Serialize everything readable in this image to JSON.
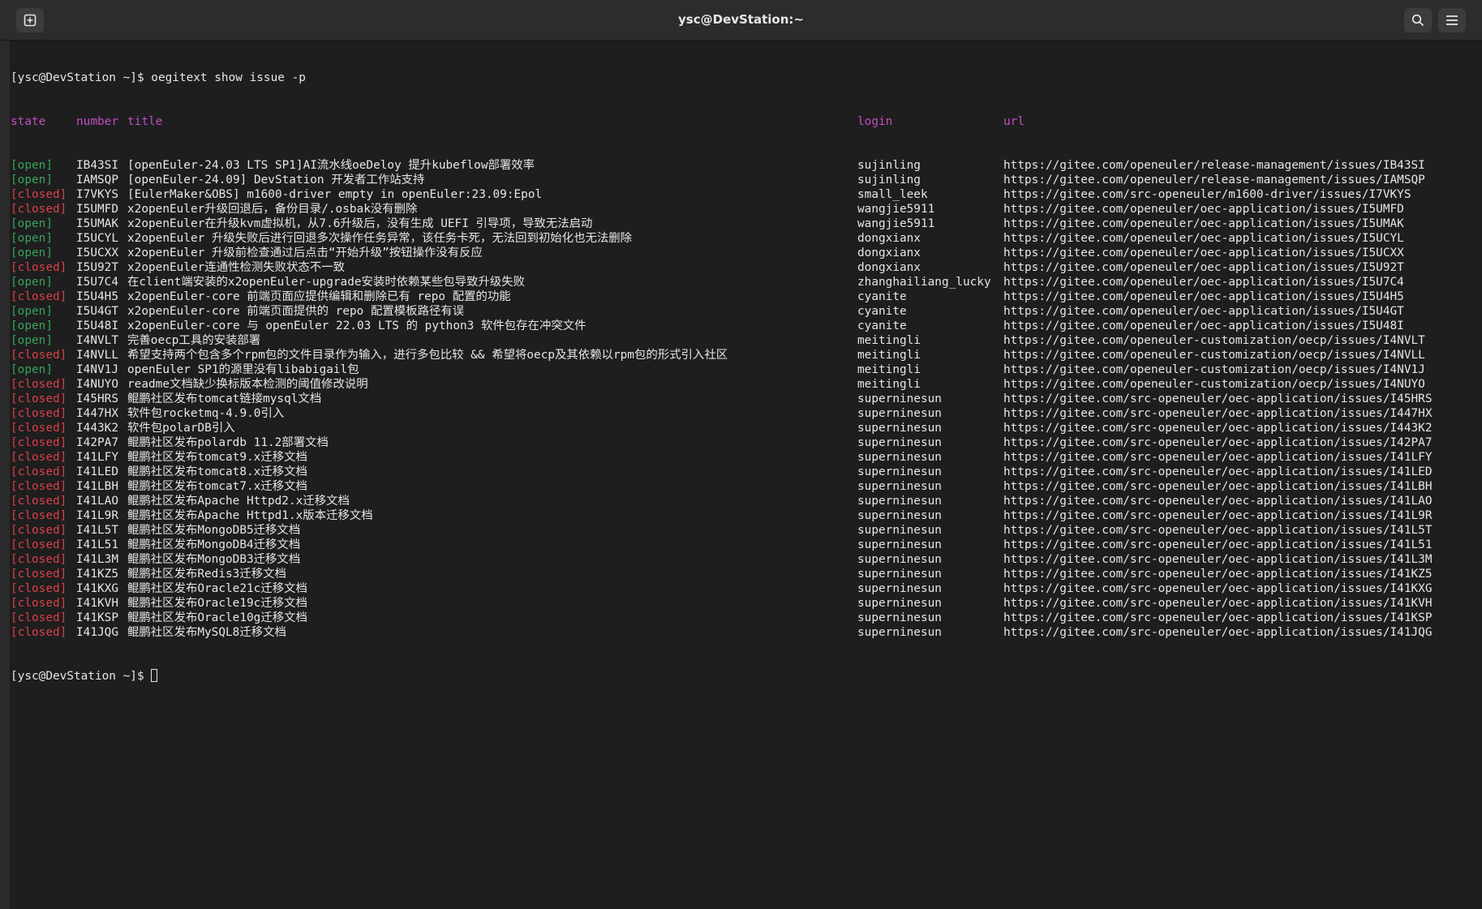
{
  "window": {
    "title": "ysc@DevStation:~",
    "new_tab_icon": "new-tab-icon",
    "search_icon": "search-icon",
    "menu_icon": "hamburger-menu-icon"
  },
  "terminal": {
    "prompt": "[ysc@DevStation ~]$",
    "command": " oegitext show issue -p",
    "headers": {
      "state": "state",
      "number": "number",
      "title": "title",
      "login": "login",
      "url": "url"
    },
    "colors": {
      "header": "#c24ec2",
      "open": "#35a35c",
      "closed": "#d9404a",
      "text": "#e6e6e6",
      "background": "#1e1e1e"
    },
    "rows": [
      {
        "state": "[open]",
        "number": "IB43SI",
        "title": "[openEuler-24.03 LTS SP1]AI流水线oeDeloy 提升kubeflow部署效率",
        "login": "sujinling",
        "url": "https://gitee.com/openeuler/release-management/issues/IB43SI"
      },
      {
        "state": "[open]",
        "number": "IAMSQP",
        "title": "[openEuler-24.09] DevStation 开发者工作站支持",
        "login": "sujinling",
        "url": "https://gitee.com/openeuler/release-management/issues/IAMSQP"
      },
      {
        "state": "[closed]",
        "number": "I7VKYS",
        "title": "[EulerMaker&OBS] m1600-driver empty in openEuler:23.09:Epol",
        "login": "small_leek",
        "url": "https://gitee.com/src-openeuler/m1600-driver/issues/I7VKYS"
      },
      {
        "state": "[closed]",
        "number": "I5UMFD",
        "title": "x2openEuler升级回退后，备份目录/.osbak没有删除",
        "login": "wangjie5911",
        "url": "https://gitee.com/openeuler/oec-application/issues/I5UMFD"
      },
      {
        "state": "[open]",
        "number": "I5UMAK",
        "title": "x2openEuler在升级kvm虚拟机，从7.6升级后，没有生成 UEFI 引导项，导致无法启动",
        "login": "wangjie5911",
        "url": "https://gitee.com/openeuler/oec-application/issues/I5UMAK"
      },
      {
        "state": "[open]",
        "number": "I5UCYL",
        "title": "x2openEuler 升级失败后进行回退多次操作任务异常，该任务卡死，无法回到初始化也无法删除",
        "login": "dongxianx",
        "url": "https://gitee.com/openeuler/oec-application/issues/I5UCYL"
      },
      {
        "state": "[open]",
        "number": "I5UCXX",
        "title": "x2openEuler 升级前检查通过后点击“开始升级”按钮操作没有反应",
        "login": "dongxianx",
        "url": "https://gitee.com/openeuler/oec-application/issues/I5UCXX"
      },
      {
        "state": "[closed]",
        "number": "I5U92T",
        "title": "x2openEuler连通性检测失败状态不一致",
        "login": "dongxianx",
        "url": "https://gitee.com/openeuler/oec-application/issues/I5U92T"
      },
      {
        "state": "[open]",
        "number": "I5U7C4",
        "title": "在client端安装的x2openEuler-upgrade安装时依赖某些包导致升级失败",
        "login": "zhanghailiang_lucky",
        "url": "https://gitee.com/openeuler/oec-application/issues/I5U7C4"
      },
      {
        "state": "[closed]",
        "number": "I5U4H5",
        "title": "x2openEuler-core 前端页面应提供编辑和删除已有 repo 配置的功能",
        "login": "cyanite",
        "url": "https://gitee.com/openeuler/oec-application/issues/I5U4H5"
      },
      {
        "state": "[open]",
        "number": "I5U4GT",
        "title": "x2openEuler-core 前端页面提供的 repo 配置模板路径有误",
        "login": "cyanite",
        "url": "https://gitee.com/openeuler/oec-application/issues/I5U4GT"
      },
      {
        "state": "[open]",
        "number": "I5U48I",
        "title": "x2openEuler-core 与 openEuler 22.03 LTS 的 python3 软件包存在冲突文件",
        "login": "cyanite",
        "url": "https://gitee.com/openeuler/oec-application/issues/I5U48I"
      },
      {
        "state": "[open]",
        "number": "I4NVLT",
        "title": "完善oecp工具的安装部署",
        "login": "meitingli",
        "url": "https://gitee.com/openeuler-customization/oecp/issues/I4NVLT"
      },
      {
        "state": "[closed]",
        "number": "I4NVLL",
        "title": "希望支持两个包含多个rpm包的文件目录作为输入，进行多包比较 && 希望将oecp及其依赖以rpm包的形式引入社区",
        "login": "meitingli",
        "url": "https://gitee.com/openeuler-customization/oecp/issues/I4NVLL"
      },
      {
        "state": "[open]",
        "number": "I4NV1J",
        "title": "openEuler SP1的源里没有libabigail包",
        "login": "meitingli",
        "url": "https://gitee.com/openeuler-customization/oecp/issues/I4NV1J"
      },
      {
        "state": "[closed]",
        "number": "I4NUYO",
        "title": "readme文档缺少换标版本检测的阈值修改说明",
        "login": "meitingli",
        "url": "https://gitee.com/openeuler-customization/oecp/issues/I4NUYO"
      },
      {
        "state": "[closed]",
        "number": "I45HRS",
        "title": "鲲鹏社区发布tomcat链接mysql文档",
        "login": "superninesun",
        "url": "https://gitee.com/src-openeuler/oec-application/issues/I45HRS"
      },
      {
        "state": "[closed]",
        "number": "I447HX",
        "title": "软件包rocketmq-4.9.0引入",
        "login": "superninesun",
        "url": "https://gitee.com/src-openeuler/oec-application/issues/I447HX"
      },
      {
        "state": "[closed]",
        "number": "I443K2",
        "title": "软件包polarDB引入",
        "login": "superninesun",
        "url": "https://gitee.com/src-openeuler/oec-application/issues/I443K2"
      },
      {
        "state": "[closed]",
        "number": "I42PA7",
        "title": "鲲鹏社区发布polardb 11.2部署文档",
        "login": "superninesun",
        "url": "https://gitee.com/src-openeuler/oec-application/issues/I42PA7"
      },
      {
        "state": "[closed]",
        "number": "I41LFY",
        "title": "鲲鹏社区发布tomcat9.x迁移文档",
        "login": "superninesun",
        "url": "https://gitee.com/src-openeuler/oec-application/issues/I41LFY"
      },
      {
        "state": "[closed]",
        "number": "I41LED",
        "title": "鲲鹏社区发布tomcat8.x迁移文档",
        "login": "superninesun",
        "url": "https://gitee.com/src-openeuler/oec-application/issues/I41LED"
      },
      {
        "state": "[closed]",
        "number": "I41LBH",
        "title": "鲲鹏社区发布tomcat7.x迁移文档",
        "login": "superninesun",
        "url": "https://gitee.com/src-openeuler/oec-application/issues/I41LBH"
      },
      {
        "state": "[closed]",
        "number": "I41LAO",
        "title": "鲲鹏社区发布Apache Httpd2.x迁移文档",
        "login": "superninesun",
        "url": "https://gitee.com/src-openeuler/oec-application/issues/I41LAO"
      },
      {
        "state": "[closed]",
        "number": "I41L9R",
        "title": "鲲鹏社区发布Apache Httpd1.x版本迁移文档",
        "login": "superninesun",
        "url": "https://gitee.com/src-openeuler/oec-application/issues/I41L9R"
      },
      {
        "state": "[closed]",
        "number": "I41L5T",
        "title": "鲲鹏社区发布MongoDB5迁移文档",
        "login": "superninesun",
        "url": "https://gitee.com/src-openeuler/oec-application/issues/I41L5T"
      },
      {
        "state": "[closed]",
        "number": "I41L51",
        "title": "鲲鹏社区发布MongoDB4迁移文档",
        "login": "superninesun",
        "url": "https://gitee.com/src-openeuler/oec-application/issues/I41L51"
      },
      {
        "state": "[closed]",
        "number": "I41L3M",
        "title": "鲲鹏社区发布MongoDB3迁移文档",
        "login": "superninesun",
        "url": "https://gitee.com/src-openeuler/oec-application/issues/I41L3M"
      },
      {
        "state": "[closed]",
        "number": "I41KZ5",
        "title": "鲲鹏社区发布Redis3迁移文档",
        "login": "superninesun",
        "url": "https://gitee.com/src-openeuler/oec-application/issues/I41KZ5"
      },
      {
        "state": "[closed]",
        "number": "I41KXG",
        "title": "鲲鹏社区发布Oracle21c迁移文档",
        "login": "superninesun",
        "url": "https://gitee.com/src-openeuler/oec-application/issues/I41KXG"
      },
      {
        "state": "[closed]",
        "number": "I41KVH",
        "title": "鲲鹏社区发布Oracle19c迁移文档",
        "login": "superninesun",
        "url": "https://gitee.com/src-openeuler/oec-application/issues/I41KVH"
      },
      {
        "state": "[closed]",
        "number": "I41KSP",
        "title": "鲲鹏社区发布Oracle10g迁移文档",
        "login": "superninesun",
        "url": "https://gitee.com/src-openeuler/oec-application/issues/I41KSP"
      },
      {
        "state": "[closed]",
        "number": "I41JQG",
        "title": "鲲鹏社区发布MySQL8迁移文档",
        "login": "superninesun",
        "url": "https://gitee.com/src-openeuler/oec-application/issues/I41JQG"
      }
    ],
    "final_prompt": "[ysc@DevStation ~]$ "
  }
}
